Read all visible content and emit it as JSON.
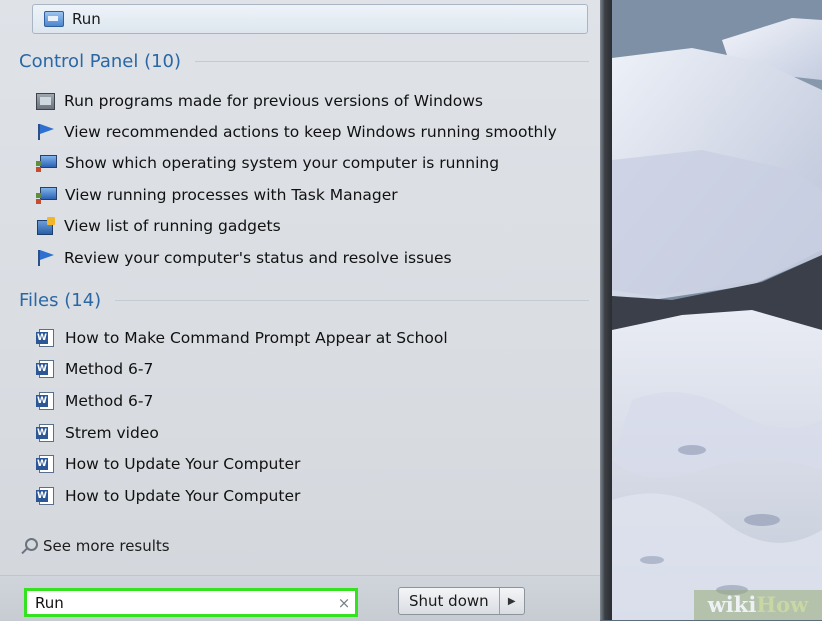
{
  "top_result": {
    "label": "Run",
    "icon": "run-icon"
  },
  "control_panel": {
    "heading": "Control Panel (10)",
    "items": [
      {
        "label": "Run programs made for previous versions of Windows",
        "icon": "program-compatibility-icon"
      },
      {
        "label": "View recommended actions to keep Windows running smoothly",
        "icon": "action-center-flag-icon"
      },
      {
        "label": "Show which operating system your computer is running",
        "icon": "system-monitor-icon"
      },
      {
        "label": "View running processes with Task Manager",
        "icon": "task-manager-icon"
      },
      {
        "label": "View list of running gadgets",
        "icon": "gadgets-icon"
      },
      {
        "label": "Review your computer's status and resolve issues",
        "icon": "action-center-flag-icon"
      }
    ]
  },
  "files": {
    "heading": "Files (14)",
    "items": [
      {
        "label": "How to Make Command Prompt Appear at School",
        "icon": "word-document-icon"
      },
      {
        "label": "Method 6-7",
        "icon": "word-document-icon"
      },
      {
        "label": "Method 6-7",
        "icon": "word-document-icon"
      },
      {
        "label": "Strem video",
        "icon": "word-document-icon"
      },
      {
        "label": "How to Update Your Computer",
        "icon": "word-document-icon"
      },
      {
        "label": "How to Update Your Computer",
        "icon": "word-document-icon"
      }
    ]
  },
  "see_more": {
    "label": "See more results",
    "icon": "search-icon"
  },
  "search": {
    "value": "Run",
    "clear_glyph": "×"
  },
  "power": {
    "label": "Shut down",
    "arrow_glyph": "▶"
  },
  "watermark": {
    "part1": "wiki",
    "part2": "How"
  },
  "colors": {
    "section_heading": "#2a67a4",
    "search_highlight": "#35e21f",
    "menu_background": "#dfe3e8"
  }
}
